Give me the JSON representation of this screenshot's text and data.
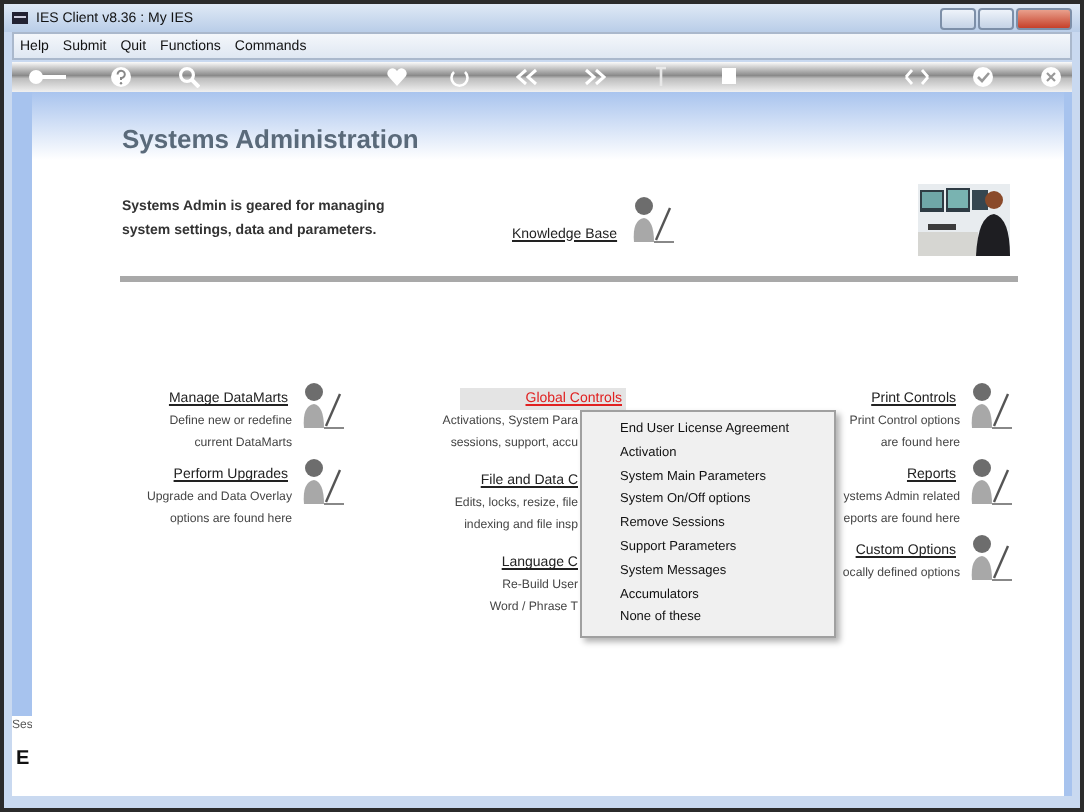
{
  "window": {
    "title": "IES Client v8.36 : My IES"
  },
  "menu_bar": [
    "Help",
    "Submit",
    "Quit",
    "Functions",
    "Commands"
  ],
  "page": {
    "title": "Systems Administration",
    "intro_lines": [
      "Systems Admin is geared for managing",
      "system settings, data and parameters."
    ],
    "knowledge_link": "Knowledge Base",
    "photo": {
      "kind": "picture"
    }
  },
  "columns": [
    [
      {
        "title": "Manage DataMarts",
        "hovered": false,
        "lines": [
          "Define new or redefine",
          "current DataMarts"
        ]
      },
      {
        "title": "Perform Upgrades",
        "hovered": false,
        "lines": [
          "Upgrade and Data Overlay",
          "options are found here"
        ]
      }
    ],
    [
      {
        "title": "Global Controls",
        "hovered": true,
        "lines": [
          "Activations, System Para",
          "sessions, support, accu"
        ]
      },
      {
        "title": "File and Data C",
        "hovered": false,
        "lines": [
          "Edits, locks, resize, file",
          "indexing and file insp"
        ]
      },
      {
        "title": "Language C",
        "hovered": false,
        "lines": [
          "Re-Build User",
          "Word / Phrase T"
        ]
      }
    ],
    [
      {
        "title": "Print Controls",
        "hovered": false,
        "lines": [
          "Print Control options",
          "are found here"
        ]
      },
      {
        "title": "Reports",
        "hovered": false,
        "lines": [
          "ystems Admin related",
          "eports are found here"
        ]
      },
      {
        "title": "Custom Options",
        "hovered": false,
        "lines": [
          "ocally defined options"
        ]
      }
    ]
  ],
  "context_menu": {
    "items": [
      "End User License Agreement",
      "Activation",
      "System Main Parameters",
      "System On/Off options",
      "Remove Sessions",
      "Support Parameters",
      "System Messages",
      "Accumulators",
      "None of these"
    ]
  },
  "side_panel": {
    "label": "Ses",
    "letter": "E"
  }
}
